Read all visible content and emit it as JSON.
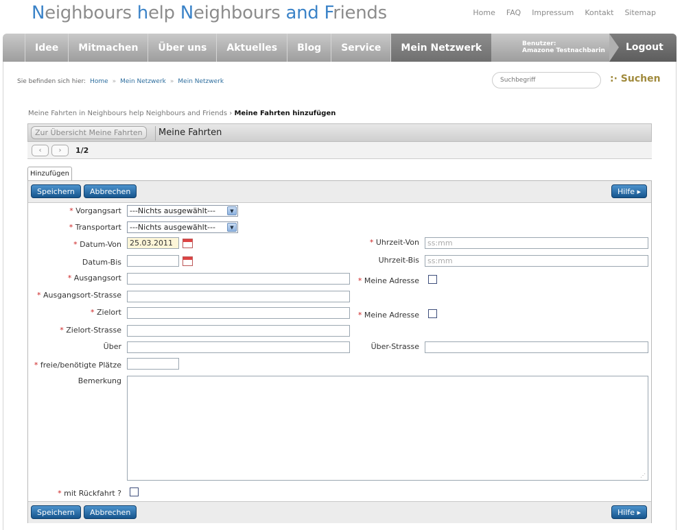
{
  "logo": {
    "p1_c": "N",
    "p1": "eighbours ",
    "p2_c": "h",
    "p2": "elp ",
    "p3_c": "N",
    "p3": "eighbours ",
    "p4_c": "and ",
    "p5_c": "F",
    "p5": "riends"
  },
  "toplinks": [
    "Home",
    "FAQ",
    "Impressum",
    "Kontakt",
    "Sitemap"
  ],
  "nav": {
    "items": [
      "Idee",
      "Mitmachen",
      "Über uns",
      "Aktuelles",
      "Blog",
      "Service",
      "Mein Netzwerk"
    ],
    "user_label": "Benutzer:",
    "user_name": "Amazone Testnachbarin",
    "logout": "Logout"
  },
  "breadcrumb": {
    "prefix": "Sie befinden sich hier:",
    "items": [
      "Home",
      "Mein Netzwerk",
      "Mein Netzwerk"
    ]
  },
  "search": {
    "placeholder": "Suchbegriff",
    "button": ":· Suchen"
  },
  "crumbline": {
    "path": "Meine Fahrten in Neighbours help Neighbours and Friends",
    "sep": "›",
    "current": "Meine Fahrten hinzufügen"
  },
  "titlebar": {
    "back": "Zur Übersicht Meine Fahrten",
    "title": "Meine Fahrten"
  },
  "pager": {
    "prev": "‹",
    "next": "›",
    "page": "1/2"
  },
  "tab": "Hinzufügen",
  "buttons": {
    "save": "Speichern",
    "cancel": "Abbrechen",
    "help": "Hilfe ▸"
  },
  "form": {
    "vorgangsart": {
      "label": "Vorgangsart",
      "value": "---Nichts ausgewählt---"
    },
    "transportart": {
      "label": "Transportart",
      "value": "---Nichts ausgewählt---"
    },
    "datum_von": {
      "label": "Datum-Von",
      "value": "25.03.2011"
    },
    "uhrzeit_von": {
      "label": "Uhrzeit-Von",
      "placeholder": "ss:mm"
    },
    "datum_bis": {
      "label": "Datum-Bis",
      "value": ""
    },
    "uhrzeit_bis": {
      "label": "Uhrzeit-Bis",
      "placeholder": "ss:mm"
    },
    "ausgangsort": {
      "label": "Ausgangsort"
    },
    "meine_adresse_1": {
      "label": "Meine Adresse"
    },
    "ausgangsort_strasse": {
      "label": "Ausgangsort-Strasse"
    },
    "zielort": {
      "label": "Zielort"
    },
    "meine_adresse_2": {
      "label": "Meine Adresse"
    },
    "zielort_strasse": {
      "label": "Zielort-Strasse"
    },
    "ueber": {
      "label": "Über"
    },
    "ueber_strasse": {
      "label": "Über-Strasse"
    },
    "plaetze": {
      "label": "freie/benötigte Plätze"
    },
    "bemerkung": {
      "label": "Bemerkung"
    },
    "rueckfahrt": {
      "label": "mit Rückfahrt ?"
    },
    "required_mark": "*"
  },
  "colors": {
    "accent": "#3b83c8",
    "button_blue": "#16558d",
    "search_gold": "#a08a3c",
    "required": "#cc2222"
  }
}
